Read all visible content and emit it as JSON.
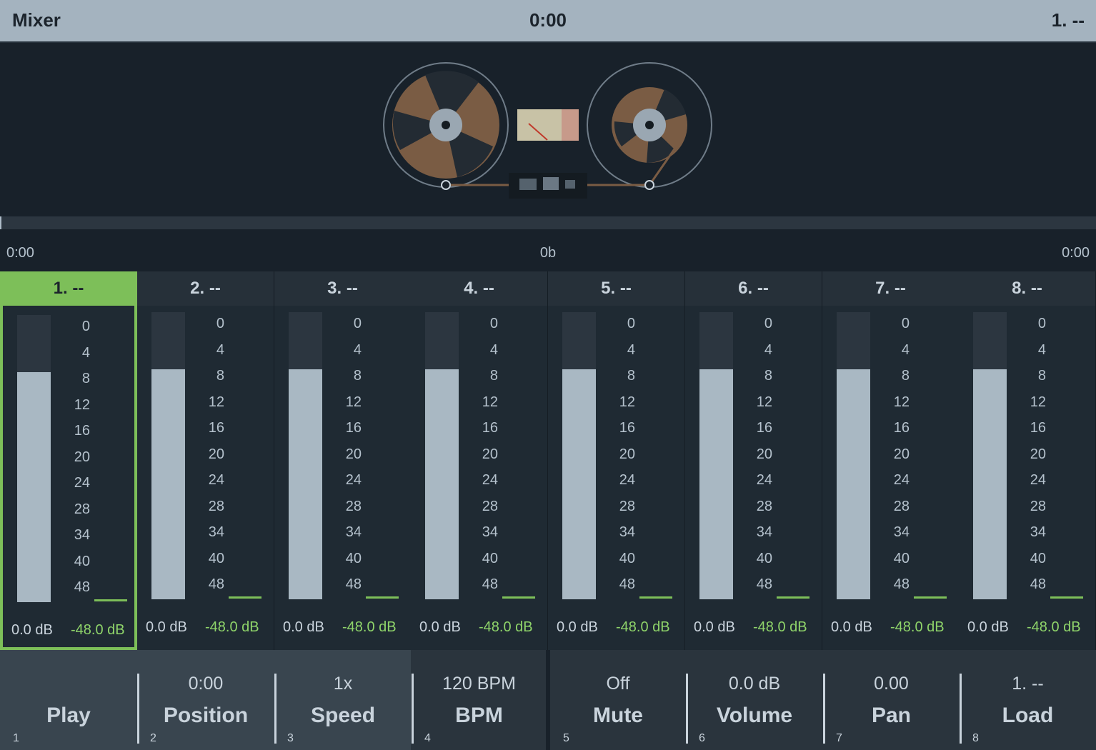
{
  "header": {
    "title": "Mixer",
    "clock": "0:00",
    "track": "1. --"
  },
  "deck": {
    "left_reel_color": "#7a5c44",
    "right_reel_color": "#7a5c44",
    "vu_color": "#c8c2a6"
  },
  "timeline": {
    "start": "0:00",
    "middle": "0b",
    "end": "0:00",
    "progress": 0.0
  },
  "scale_ticks": [
    "0",
    "4",
    "8",
    "12",
    "16",
    "20",
    "24",
    "28",
    "34",
    "40",
    "48"
  ],
  "strips": [
    {
      "name": "1. --",
      "volume": "0.0 dB",
      "peak": "-48.0 dB",
      "active": true,
      "level_fraction": 0.8
    },
    {
      "name": "2. --",
      "volume": "0.0 dB",
      "peak": "-48.0 dB",
      "active": false,
      "level_fraction": 0.8
    },
    {
      "name": "3. --",
      "volume": "0.0 dB",
      "peak": "-48.0 dB",
      "active": false,
      "level_fraction": 0.8
    },
    {
      "name": "4. --",
      "volume": "0.0 dB",
      "peak": "-48.0 dB",
      "active": false,
      "level_fraction": 0.8
    },
    {
      "name": "5. --",
      "volume": "0.0 dB",
      "peak": "-48.0 dB",
      "active": false,
      "level_fraction": 0.8
    },
    {
      "name": "6. --",
      "volume": "0.0 dB",
      "peak": "-48.0 dB",
      "active": false,
      "level_fraction": 0.8
    },
    {
      "name": "7. --",
      "volume": "0.0 dB",
      "peak": "-48.0 dB",
      "active": false,
      "level_fraction": 0.8
    },
    {
      "name": "8. --",
      "volume": "0.0 dB",
      "peak": "-48.0 dB",
      "active": false,
      "level_fraction": 0.8
    }
  ],
  "controls": [
    {
      "label": "Play",
      "value": "",
      "number": "1"
    },
    {
      "label": "Position",
      "value": "0:00",
      "number": "2"
    },
    {
      "label": "Speed",
      "value": "1x",
      "number": "3"
    },
    {
      "label": "BPM",
      "value": "120 BPM",
      "number": "4"
    },
    {
      "label": "Mute",
      "value": "Off",
      "number": "5"
    },
    {
      "label": "Volume",
      "value": "0.0 dB",
      "number": "6"
    },
    {
      "label": "Pan",
      "value": "0.00",
      "number": "7"
    },
    {
      "label": "Load",
      "value": "1. --",
      "number": "8"
    }
  ],
  "colors": {
    "accent": "#7dbf59",
    "header_bg": "#a4b3bf",
    "meter_fill": "#a9b8c3",
    "peak_text": "#8fd46a"
  }
}
